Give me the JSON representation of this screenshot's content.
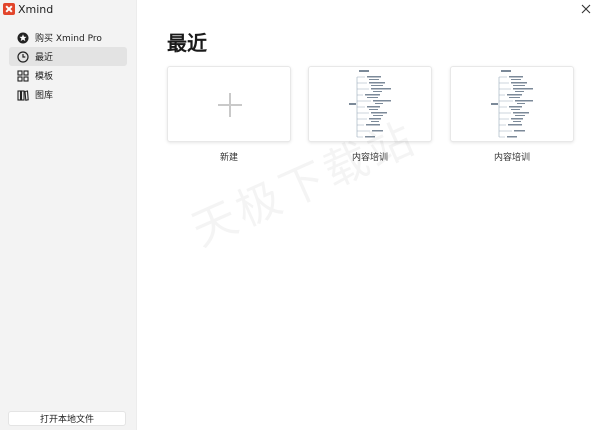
{
  "app": {
    "name": "Xmind"
  },
  "sidebar": {
    "items": [
      {
        "label": "购买 Xmind Pro",
        "icon": "star-badge-icon"
      },
      {
        "label": "最近",
        "icon": "clock-icon",
        "active": true
      },
      {
        "label": "模板",
        "icon": "grid-icon"
      },
      {
        "label": "图库",
        "icon": "library-icon"
      }
    ],
    "open_local_file": "打开本地文件"
  },
  "main": {
    "title": "最近",
    "cards": [
      {
        "label": "新建",
        "type": "new"
      },
      {
        "label": "内容培训",
        "type": "file"
      },
      {
        "label": "内容培训",
        "type": "file"
      }
    ]
  },
  "watermark": "天极下载站",
  "colors": {
    "brand": "#e2452b",
    "sidebar_bg": "#f3f3f3",
    "active_bg": "#e3e3e3"
  }
}
